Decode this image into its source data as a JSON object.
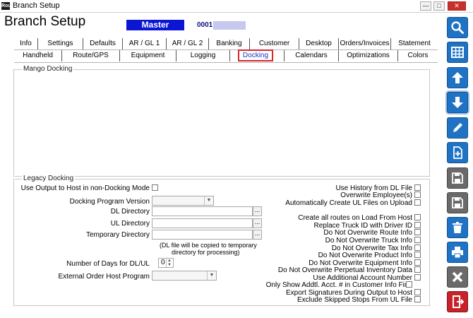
{
  "window": {
    "title": "Branch Setup",
    "app_icon": "Rout",
    "minimize": "—",
    "maximize": "□",
    "close": "✕"
  },
  "header": {
    "title": "Branch Setup",
    "branch_name": "Master Branch",
    "branch_code": "0001"
  },
  "tabs": {
    "row1": [
      "Info",
      "Settings",
      "Defaults",
      "AR / GL 1",
      "AR / GL 2",
      "Banking",
      "Customer",
      "Desktop",
      "Orders/Invoices",
      "Statement"
    ],
    "row2": [
      "Handheld",
      "Route/GPS",
      "Equipment",
      "Logging",
      "Docking",
      "Calendars",
      "Optimizations",
      "Colors"
    ],
    "active": "Docking"
  },
  "mango": {
    "label": "Mango Docking"
  },
  "legacy": {
    "label": "Legacy Docking",
    "use_output_label": "Use Output to Host in non-Docking Mode",
    "docking_program_version_label": "Docking Program Version",
    "dl_directory_label": "DL Directory",
    "ul_directory_label": "UL Directory",
    "temporary_directory_label": "Temporary Directory",
    "browse": "...",
    "note_line1": "(DL file will be copied to temporary",
    "note_line2": "directory for processing)",
    "days_label": "Number of Days for DL/UL",
    "days_value": "0",
    "external_order_label": "External Order Host Program",
    "right_options": [
      "Use History from DL File",
      "Overwrite Employee(s)",
      "Automatically Create UL Files on Upload",
      "Create all routes on Load From Host",
      "Replace Truck ID with  Driver ID",
      "Do Not Overwrite Route Info",
      "Do Not Overwrite Truck Info",
      "Do Not Overwrite Tax Info",
      "Do Not Overwrite Product Info",
      "Do Not Overwrite Equipment Info",
      "Do Not Overwrite Perpetual Inventory Data",
      "Use Additional Account Number",
      "Only Show Addtl. Acct. # in Customer Info Find",
      "Export Signatures During Output to Host",
      "Exclude Skipped Stops From UL File"
    ]
  },
  "toolbar": {
    "icons": [
      "search-icon",
      "grid-icon",
      "arrow-up-icon",
      "arrow-down-icon",
      "pencil-icon",
      "new-document-icon",
      "save-as-icon",
      "save-icon",
      "delete-icon",
      "print-icon",
      "close-icon",
      "exit-icon"
    ]
  }
}
